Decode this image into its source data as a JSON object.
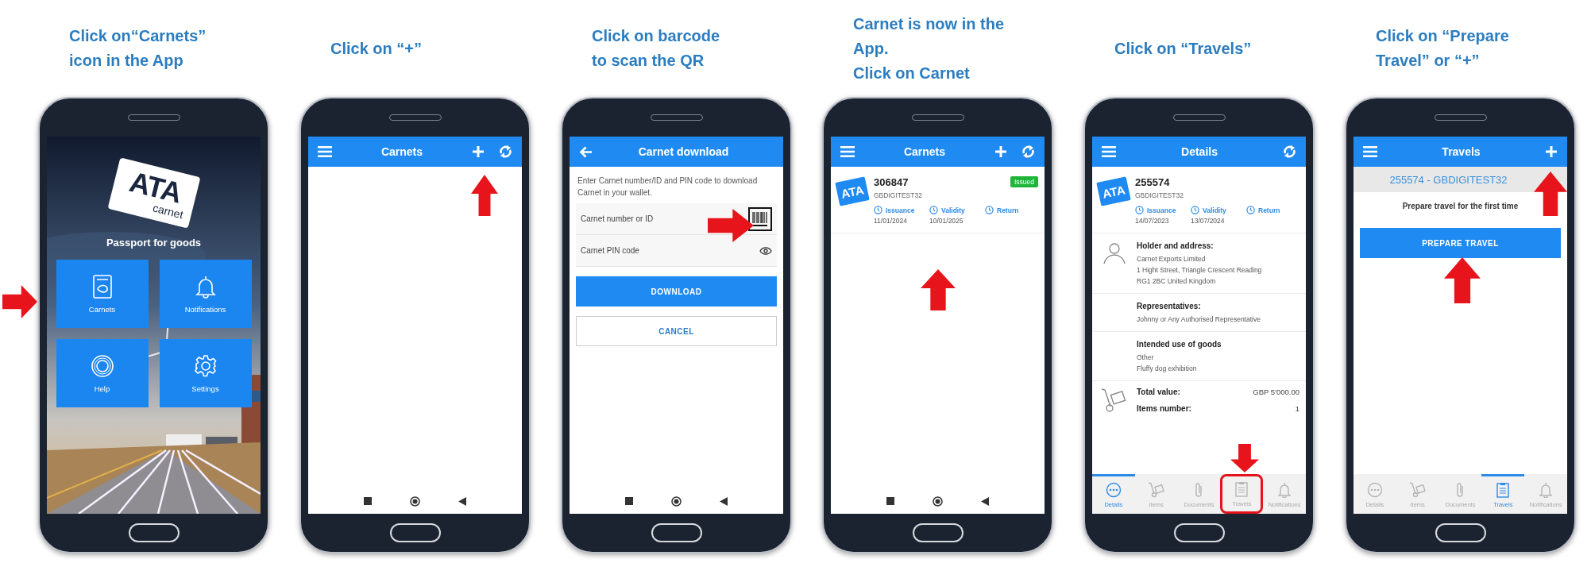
{
  "steps": [
    {
      "caption": [
        "Click on“Carnets”",
        "icon in the App"
      ],
      "android_nav": false,
      "screen": {
        "kind": "home",
        "logo": {
          "title": "ATA",
          "subtitle": "carnet"
        },
        "tagline": "Passport for goods",
        "tiles": [
          "Carnets",
          "Notifications",
          "Help",
          "Settings"
        ]
      }
    },
    {
      "caption": [
        "Click on “+”"
      ],
      "android_nav": true,
      "screen": {
        "kind": "list",
        "title": "Carnets"
      }
    },
    {
      "caption": [
        "Click on barcode",
        "to scan the QR"
      ],
      "android_nav": true,
      "screen": {
        "kind": "download",
        "title": "Carnet download",
        "intro": "Enter Carnet number/ID and PIN code to download Carnet in your wallet.",
        "fields": [
          {
            "kind": "barcode",
            "placeholder": "Carnet number or ID"
          },
          {
            "kind": "password",
            "placeholder": "Carnet PIN code"
          }
        ],
        "primary": "DOWNLOAD",
        "secondary": "CANCEL"
      }
    },
    {
      "caption": [
        "Carnet is now in the",
        "App.",
        "Click on Carnet"
      ],
      "android_nav": true,
      "screen": {
        "kind": "list",
        "title": "Carnets",
        "carnet": {
          "logo": "ATA",
          "number": "306847",
          "holder_id": "GBDIGITEST32",
          "status": "Issued",
          "dates": [
            {
              "label": "Issuance",
              "value": "11/01/2024"
            },
            {
              "label": "Validity",
              "value": "10/01/2025"
            },
            {
              "label": "Return"
            }
          ]
        }
      }
    },
    {
      "caption": [
        "Click on “Travels”"
      ],
      "android_nav": false,
      "screen": {
        "kind": "details",
        "title": "Details",
        "carnet": {
          "logo": "ATA",
          "number": "255574",
          "holder_id": "GBDIGITEST32",
          "dates": [
            {
              "label": "Issuance",
              "value": "14/07/2023"
            },
            {
              "label": "Validity",
              "value": "13/07/2024"
            },
            {
              "label": "Return"
            }
          ]
        },
        "sections": [
          {
            "heading": "Holder and address:",
            "lines": [
              "Carnet Exports Limited",
              "1 Hight Street, Triangle Crescent Reading",
              "RG1 2BC United Kingdom"
            ]
          },
          {
            "heading": "Representatives:",
            "lines": [
              "Johnny or Any Authorised Representative"
            ]
          },
          {
            "heading": "Intended use of goods",
            "lines": [
              "Other",
              "Fluffy dog exhibition"
            ]
          }
        ],
        "totals": [
          {
            "label": "Total value:",
            "value": "GBP 5'000.00"
          },
          {
            "label": "Items number:",
            "value": "1"
          }
        ],
        "tabs": [
          {
            "label": "Details",
            "selected": true,
            "highlighted": false
          },
          {
            "label": "Items",
            "selected": false,
            "highlighted": false
          },
          {
            "label": "Documents",
            "selected": false,
            "highlighted": false
          },
          {
            "label": "Travels",
            "selected": false,
            "highlighted": true
          },
          {
            "label": "Notifications",
            "selected": false,
            "highlighted": false
          }
        ]
      }
    },
    {
      "caption": [
        "Click on “Prepare",
        "Travel” or “+”"
      ],
      "android_nav": false,
      "screen": {
        "kind": "travels",
        "title": "Travels",
        "subtitle": "255574 - GBDIGITEST32",
        "message": "Prepare travel for the first time",
        "primary": "PREPARE TRAVEL",
        "tabs": [
          {
            "label": "Details",
            "selected": false,
            "highlighted": false
          },
          {
            "label": "Items",
            "selected": false,
            "highlighted": false
          },
          {
            "label": "Documents",
            "selected": false,
            "highlighted": false
          },
          {
            "label": "Travels",
            "selected": true,
            "highlighted": false
          },
          {
            "label": "Notifications",
            "selected": false,
            "highlighted": false
          }
        ]
      }
    }
  ]
}
